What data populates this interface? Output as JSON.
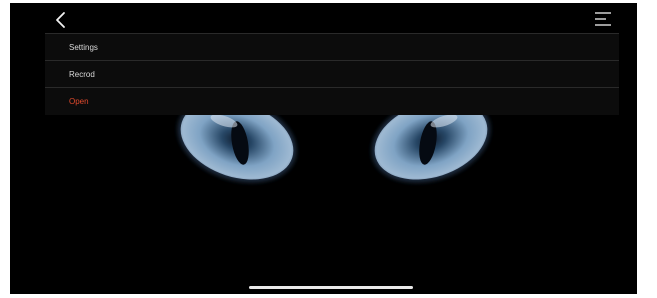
{
  "menu": {
    "items": [
      {
        "label": "Settings",
        "active": false
      },
      {
        "label": "Recrod",
        "active": false
      },
      {
        "label": "Open",
        "active": true
      }
    ]
  },
  "icons": {
    "back": "chevron-left-icon",
    "menu": "hamburger-menu-icon"
  },
  "colors": {
    "background": "#000000",
    "active_item": "#e24a2d",
    "menu_text": "#d9d9d9",
    "eye_iris": "#6f90b3"
  }
}
